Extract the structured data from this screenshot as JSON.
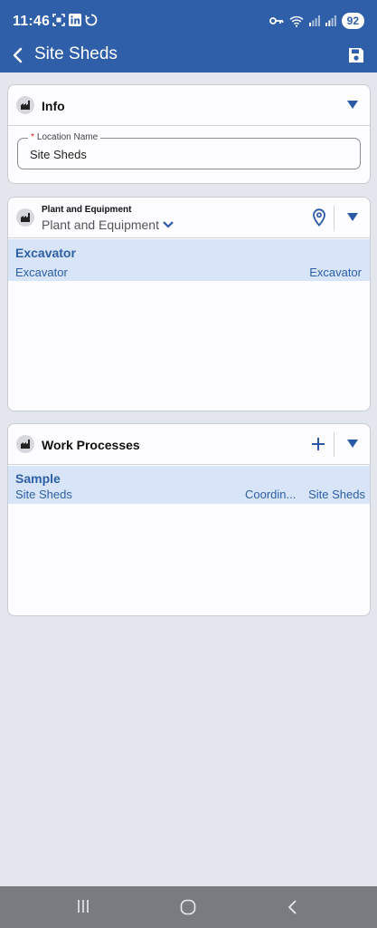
{
  "status_bar": {
    "time": "11:46",
    "battery": "92"
  },
  "app_bar": {
    "title": "Site Sheds"
  },
  "info_card": {
    "title": "Info",
    "location_field": {
      "label": "Location Name",
      "required_marker": "*",
      "value": "Site Sheds"
    }
  },
  "plant_card": {
    "label": "Plant and Equipment",
    "selected": "Plant and Equipment",
    "items": [
      {
        "title": "Excavator",
        "left": "Excavator",
        "right": "Excavator"
      }
    ]
  },
  "work_card": {
    "title": "Work Processes",
    "items": [
      {
        "title": "Sample",
        "left": "Site Sheds",
        "middle": "Coordin...",
        "right": "Site Sheds"
      }
    ]
  },
  "colors": {
    "brand": "#2f5fa8",
    "accent": "#2a5aa5",
    "row_highlight": "#d8e4f8",
    "background": "#e3e6ec"
  },
  "icons": [
    "back-arrow-icon",
    "save-icon",
    "factory-icon",
    "chevron-down-icon",
    "location-pin-icon",
    "plus-icon",
    "expand-triangle-icon"
  ]
}
